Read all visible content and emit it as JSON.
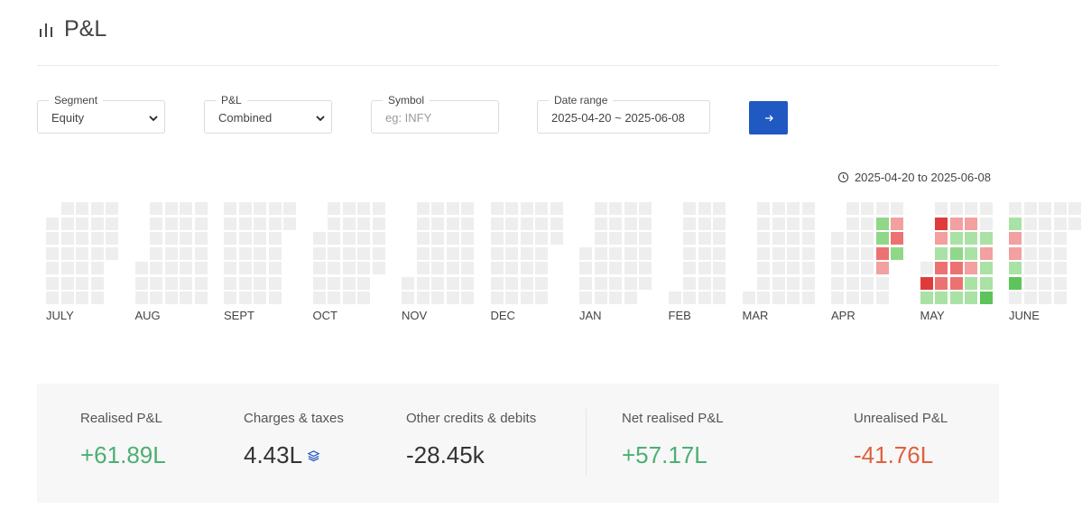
{
  "colors": {
    "empty": "#eeeeee",
    "profit_light": "#a9e2a4",
    "profit_mid": "#8fd88a",
    "profit_dark": "#5cc45a",
    "loss_light": "#f2a0a0",
    "loss_mid": "#ec7272",
    "loss_dark": "#e03b3b",
    "positive_text": "#4caf73",
    "negative_text": "#e0603e",
    "accent": "#2059c1"
  },
  "header": {
    "title": "P&L",
    "icon": "bar-chart-icon"
  },
  "filters": {
    "segment": {
      "label": "Segment",
      "value": "Equity"
    },
    "pnl": {
      "label": "P&L",
      "value": "Combined"
    },
    "symbol": {
      "label": "Symbol",
      "placeholder": "eg: INFY"
    },
    "date_range": {
      "label": "Date range",
      "value": "2025-04-20 ~ 2025-06-08"
    },
    "submit_icon": "arrow-right-icon"
  },
  "range_text": "2025-04-20 to 2025-06-08",
  "heatmap": {
    "months": [
      {
        "label": "JULY",
        "weeks": 5,
        "start": 1,
        "days": 31
      },
      {
        "label": "AUG",
        "weeks": 5,
        "start": 4,
        "days": 31
      },
      {
        "label": "SEPT",
        "weeks": 5,
        "start": 0,
        "days": 30
      },
      {
        "label": "OCT",
        "weeks": 5,
        "start": 2,
        "days": 31
      },
      {
        "label": "NOV",
        "weeks": 5,
        "start": 5,
        "days": 30
      },
      {
        "label": "DEC",
        "weeks": 5,
        "start": 0,
        "days": 31
      },
      {
        "label": "JAN",
        "weeks": 5,
        "start": 3,
        "days": 31
      },
      {
        "label": "FEB",
        "weeks": 4,
        "start": 6,
        "days": 28
      },
      {
        "label": "MAR",
        "weeks": 5,
        "start": 6,
        "days": 31
      },
      {
        "label": "APR",
        "weeks": 5,
        "start": 2,
        "days": 30
      },
      {
        "label": "MAY",
        "weeks": 5,
        "start": 4,
        "days": 31
      },
      {
        "label": "JUNE",
        "weeks": 5,
        "start": 0,
        "days": 30
      }
    ],
    "pnl_cells": [
      {
        "m": 9,
        "w": 3,
        "d": 1,
        "c": "profit_mid"
      },
      {
        "m": 9,
        "w": 3,
        "d": 2,
        "c": "profit_mid"
      },
      {
        "m": 9,
        "w": 3,
        "d": 3,
        "c": "loss_mid"
      },
      {
        "m": 9,
        "w": 3,
        "d": 4,
        "c": "loss_light"
      },
      {
        "m": 9,
        "w": 4,
        "d": 1,
        "c": "loss_light"
      },
      {
        "m": 9,
        "w": 4,
        "d": 2,
        "c": "loss_mid"
      },
      {
        "m": 9,
        "w": 4,
        "d": 3,
        "c": "profit_mid"
      },
      {
        "m": 9,
        "w": 4,
        "d": 4,
        "c": "profit_light"
      },
      {
        "m": 10,
        "w": 0,
        "d": 5,
        "c": "loss_dark"
      },
      {
        "m": 10,
        "w": 0,
        "d": 6,
        "c": "profit_light"
      },
      {
        "m": 10,
        "w": 1,
        "d": 1,
        "c": "loss_dark"
      },
      {
        "m": 10,
        "w": 1,
        "d": 2,
        "c": "loss_light"
      },
      {
        "m": 10,
        "w": 1,
        "d": 3,
        "c": "profit_light"
      },
      {
        "m": 10,
        "w": 1,
        "d": 4,
        "c": "loss_mid"
      },
      {
        "m": 10,
        "w": 1,
        "d": 5,
        "c": "loss_mid"
      },
      {
        "m": 10,
        "w": 1,
        "d": 6,
        "c": "profit_light"
      },
      {
        "m": 10,
        "w": 2,
        "d": 1,
        "c": "loss_light"
      },
      {
        "m": 10,
        "w": 2,
        "d": 2,
        "c": "profit_light"
      },
      {
        "m": 10,
        "w": 2,
        "d": 3,
        "c": "profit_mid"
      },
      {
        "m": 10,
        "w": 2,
        "d": 4,
        "c": "loss_mid"
      },
      {
        "m": 10,
        "w": 2,
        "d": 5,
        "c": "loss_mid"
      },
      {
        "m": 10,
        "w": 2,
        "d": 6,
        "c": "profit_light"
      },
      {
        "m": 10,
        "w": 3,
        "d": 1,
        "c": "loss_light"
      },
      {
        "m": 10,
        "w": 3,
        "d": 2,
        "c": "profit_light"
      },
      {
        "m": 10,
        "w": 3,
        "d": 3,
        "c": "profit_light"
      },
      {
        "m": 10,
        "w": 3,
        "d": 4,
        "c": "loss_light"
      },
      {
        "m": 10,
        "w": 3,
        "d": 5,
        "c": "profit_light"
      },
      {
        "m": 10,
        "w": 3,
        "d": 6,
        "c": "profit_light"
      },
      {
        "m": 10,
        "w": 4,
        "d": 2,
        "c": "profit_light"
      },
      {
        "m": 10,
        "w": 4,
        "d": 3,
        "c": "loss_light"
      },
      {
        "m": 10,
        "w": 4,
        "d": 4,
        "c": "profit_light"
      },
      {
        "m": 10,
        "w": 4,
        "d": 5,
        "c": "profit_light"
      },
      {
        "m": 10,
        "w": 4,
        "d": 6,
        "c": "profit_dark"
      },
      {
        "m": 11,
        "w": 0,
        "d": 1,
        "c": "profit_light"
      },
      {
        "m": 11,
        "w": 0,
        "d": 2,
        "c": "loss_light"
      },
      {
        "m": 11,
        "w": 0,
        "d": 3,
        "c": "loss_light"
      },
      {
        "m": 11,
        "w": 0,
        "d": 4,
        "c": "profit_light"
      },
      {
        "m": 11,
        "w": 0,
        "d": 5,
        "c": "profit_dark"
      }
    ]
  },
  "summary": [
    {
      "label": "Realised P&L",
      "value": "+61.89L",
      "tone": "positive"
    },
    {
      "label": "Charges & taxes",
      "value": "4.43L",
      "tone": "neutral",
      "icon": "layers-icon"
    },
    {
      "label": "Other credits & debits",
      "value": "-28.45k",
      "tone": "neutral"
    },
    {
      "label": "Net realised P&L",
      "value": "+57.17L",
      "tone": "positive"
    },
    {
      "label": "Unrealised P&L",
      "value": "-41.76L",
      "tone": "negative"
    }
  ]
}
